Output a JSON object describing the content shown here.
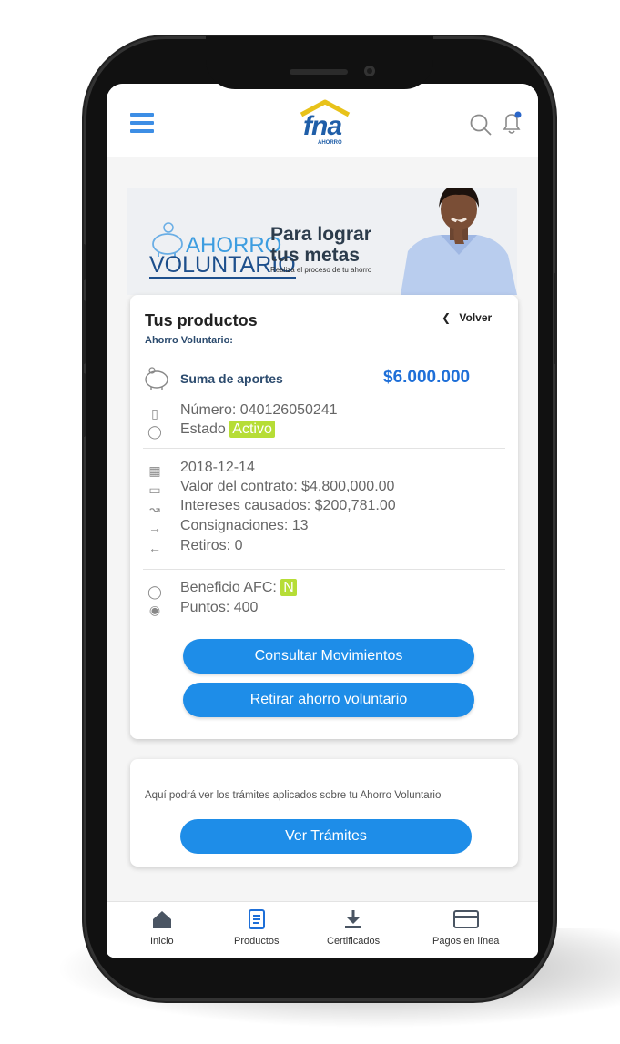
{
  "header": {
    "logo_text": "fna",
    "logo_subtext": "AHORRO",
    "icons": [
      "menu-icon",
      "search-icon",
      "bell-icon"
    ]
  },
  "banner": {
    "brand_line1": "AHORRO",
    "brand_line2": "VOLUNTARIO",
    "title_line1": "Para lograr",
    "title_line2": "tus metas",
    "subtitle": "Realiza el proceso de tu ahorro"
  },
  "products": {
    "title": "Tus productos",
    "subtitle": "Ahorro Voluntario:",
    "back_label": "Volver",
    "sum_label": "Suma de aportes",
    "sum_value": "$6.000.000",
    "number": "Número: 040126050241",
    "status_label": "Estado",
    "status_value": "Activo",
    "date": "2018-12-14",
    "contract_value": "Valor del contrato: $4,800,000.00",
    "interest": "Intereses causados: $200,781.00",
    "deposits": "Consignaciones: 13",
    "withdrawals": "Retiros: 0",
    "afc_label": "Beneficio AFC:",
    "afc_value": "N",
    "points": "Puntos: 400",
    "btn_movements": "Consultar Movimientos",
    "btn_withdraw": "Retirar ahorro voluntario"
  },
  "procedures": {
    "text": "Aquí podrá ver los trámites aplicados sobre tu Ahorro Voluntario",
    "button": "Ver Trámites"
  },
  "nav": {
    "items": [
      {
        "label": "Inicio",
        "icon": "home-icon"
      },
      {
        "label": "Productos",
        "icon": "document-icon"
      },
      {
        "label": "Certificados",
        "icon": "download-icon"
      },
      {
        "label": "Pagos en línea",
        "icon": "card-icon"
      }
    ]
  },
  "colors": {
    "accent": "#1e8de8",
    "brand": "#1f5ea8",
    "badge": "#b6dd36"
  }
}
